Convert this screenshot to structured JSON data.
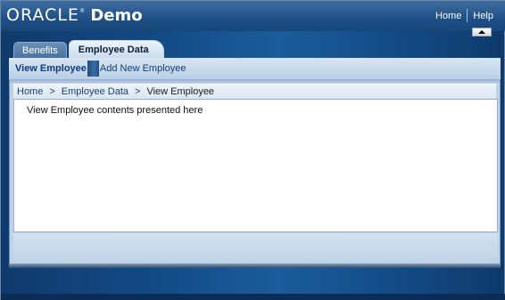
{
  "app": {
    "logo_text": "ORACLE",
    "logo_mark": "®",
    "title": "Demo"
  },
  "global_links": [
    {
      "label": "Home"
    },
    {
      "label": "Help"
    }
  ],
  "collapse_icon": "triangle-up-icon",
  "tabs": [
    {
      "label": "Benefits",
      "active": false
    },
    {
      "label": "Employee Data",
      "active": true
    }
  ],
  "subnav": {
    "selected": "View Employee",
    "link": "Add New Employee"
  },
  "breadcrumb": {
    "home": "Home",
    "section": "Employee Data",
    "current": "View Employee",
    "separator": ">"
  },
  "content": {
    "text": "View Employee contents presented here"
  }
}
